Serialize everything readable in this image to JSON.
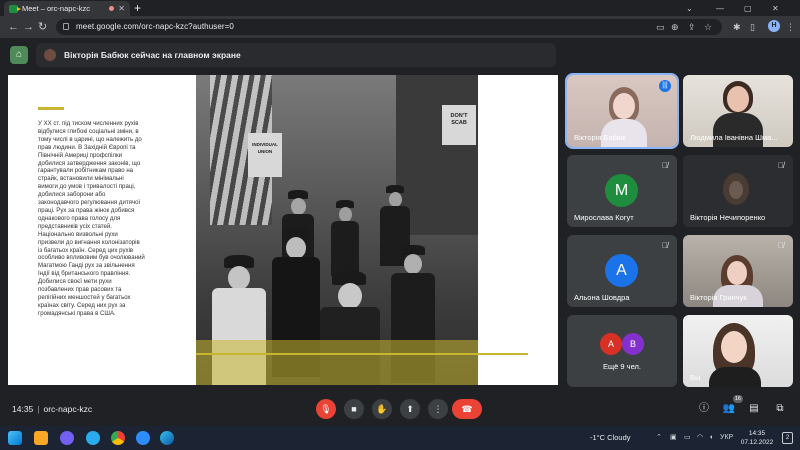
{
  "browser": {
    "tab_title": "Meet – orc-napc-kzc",
    "url": "meet.google.com/orc-napc-kzc?authuser=0",
    "profile_initial": "H"
  },
  "meet": {
    "presenter_banner": "Вікторія Бабюк сейчас на главном экране",
    "meeting_time": "14:35",
    "meeting_code": "orc-napc-kzc",
    "participants_count": "16"
  },
  "slide": {
    "text": "У ХХ ст. під тиском численних рухів\nвідбулися глибокі соціальні зміни, в\nтому числі в царині, що належить до\nправ людини. В Західній Європі та\nПівнічній Америці профспілки\nдобилися затвердження законів, що\nгарантували робітникам право на\nстрайк, встановили мінімальні\nвимоги до умов і тривалості праці,\nдобилися заборони або\nзаконодавчого регулювання дитячої\nпраці. Рух за права жінок добився\nоднакового права голосу для\nпредставників усіх статей.\nНаціонально визвольні рухи\nпризвели до вигнання колонізаторів\nіз багатьох країн. Серед цих рухів\nособливо впливовим був очолюваний\nМагатмою Ганді рух за звільнення\nІндії від британського правління.\nДобилися своєї мети рухи\nпозбавлених прав расових та\nрелігійних меншостей у багатьох\nкраїнах світу. Серед них рух за\nгромадянські права в США.",
    "sign_1": "DON'T\nSCAB",
    "sign_2": "INDIVIDUAL\nUNION"
  },
  "participants": [
    {
      "name": "Вікторія Бабюк",
      "type": "video",
      "mic": "speaking"
    },
    {
      "name": "Людмила Іванівна Шма...",
      "type": "video",
      "mic": "none"
    },
    {
      "name": "Мирослава Когут",
      "type": "avatar",
      "initial": "M",
      "color": "#1e8e3e",
      "mic": "muted"
    },
    {
      "name": "Вікторія Нечипоренко",
      "type": "video-dark",
      "mic": "muted"
    },
    {
      "name": "Альона Шовдра",
      "type": "avatar",
      "initial": "A",
      "color": "#1a73e8",
      "mic": "muted"
    },
    {
      "name": "Вікторія Гринчук",
      "type": "video",
      "mic": "muted"
    },
    {
      "name": "Ещё 9 чел.",
      "type": "more",
      "initials": [
        "A",
        "B"
      ],
      "colors": [
        "#d93025",
        "#8430ce"
      ]
    },
    {
      "name": "Вы",
      "type": "video",
      "mic": "muted"
    }
  ],
  "taskbar": {
    "weather": "-1°C  Cloudy",
    "language": "УКР",
    "time": "14:35",
    "date": "07.12.2022",
    "notifications": "2"
  }
}
